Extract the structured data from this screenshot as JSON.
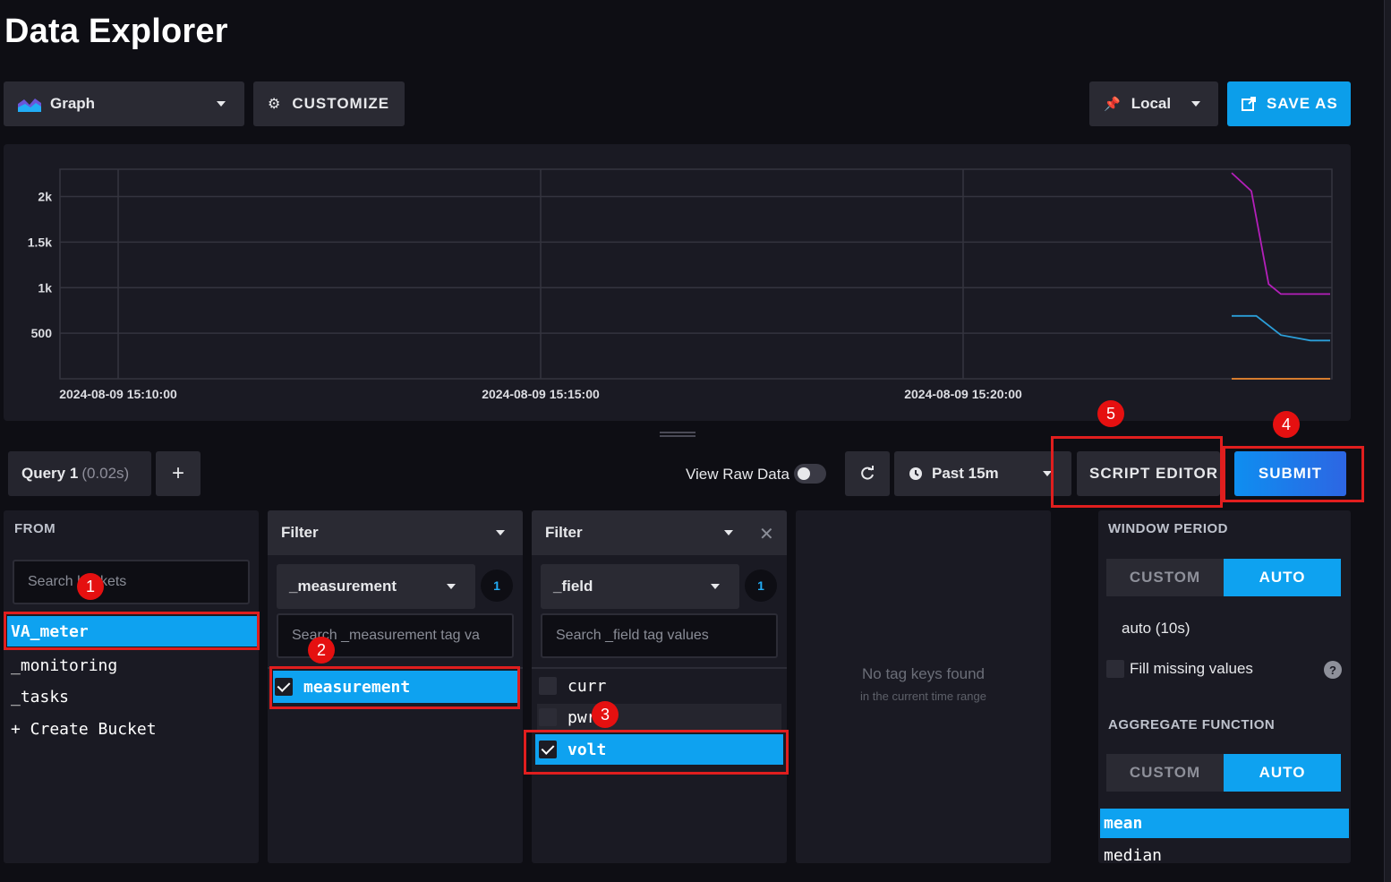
{
  "header": {
    "title": "Data Explorer"
  },
  "toolbar": {
    "graph_type": "Graph",
    "customize": "CUSTOMIZE",
    "timezone": "Local",
    "save_as": "SAVE AS"
  },
  "chart_data": {
    "type": "line",
    "y_ticks": [
      "2k",
      "1.5k",
      "1k",
      "500"
    ],
    "x_ticks": [
      "2024-08-09 15:10:00",
      "2024-08-09 15:15:00",
      "2024-08-09 15:20:00"
    ],
    "series": [
      {
        "color": "#b31fb9",
        "points": [
          [
            0.0,
            2260
          ],
          [
            0.4,
            2060
          ],
          [
            0.75,
            1040
          ],
          [
            1.0,
            930
          ],
          [
            2.0,
            930
          ]
        ]
      },
      {
        "color": "#2b9ed8",
        "points": [
          [
            0.0,
            690
          ],
          [
            0.5,
            690
          ],
          [
            1.0,
            480
          ],
          [
            1.6,
            420
          ],
          [
            2.0,
            420
          ]
        ]
      },
      {
        "color": "#f0882e",
        "points": [
          [
            0.0,
            0
          ],
          [
            2.0,
            0
          ]
        ]
      }
    ],
    "grid": true
  },
  "query_bar": {
    "query_label": "Query 1",
    "query_time": "(0.02s)",
    "add": "+",
    "view_raw": "View Raw Data",
    "time_range": "Past 15m",
    "script_editor": "SCRIPT EDITOR",
    "submit": "SUBMIT"
  },
  "from": {
    "title": "FROM",
    "search_placeholder": "Search buckets",
    "buckets": [
      "VA_meter",
      "_monitoring",
      "_tasks",
      "+ Create Bucket"
    ]
  },
  "filter1": {
    "title": "Filter",
    "tag_key": "_measurement",
    "count": "1",
    "search_placeholder": "Search _measurement tag va",
    "values": [
      "measurement"
    ]
  },
  "filter2": {
    "title": "Filter",
    "tag_key": "_field",
    "count": "1",
    "search_placeholder": "Search _field tag values",
    "values": [
      "curr",
      "pwr",
      "volt"
    ]
  },
  "filter3": {
    "empty_main": "No tag keys found",
    "empty_sub": "in the current time range"
  },
  "aggregate": {
    "window_title": "WINDOW PERIOD",
    "custom": "CUSTOM",
    "auto": "AUTO",
    "window_value": "auto (10s)",
    "fill_missing": "Fill missing values",
    "help": "?",
    "func_title": "AGGREGATE FUNCTION",
    "functions": [
      "mean",
      "median"
    ]
  },
  "annotations": [
    "1",
    "2",
    "3",
    "4",
    "5"
  ]
}
